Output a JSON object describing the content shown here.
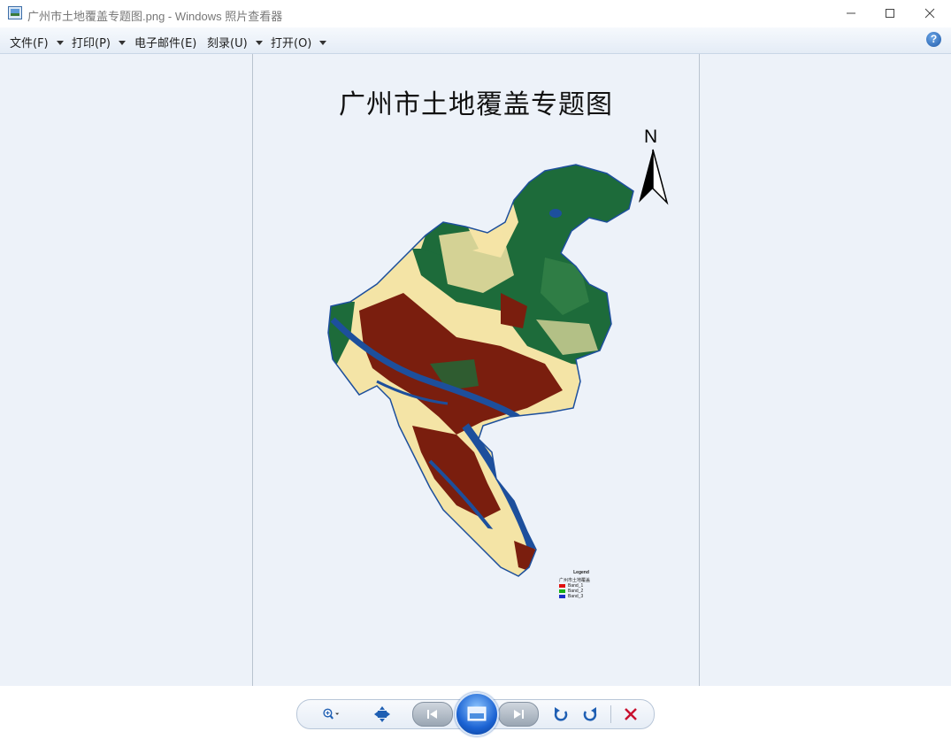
{
  "window": {
    "title": "广州市土地覆盖专题图.png - Windows 照片查看器",
    "controls": [
      "minimize",
      "maximize",
      "close"
    ]
  },
  "menu": {
    "items": [
      {
        "label": "文件(F)",
        "has_dropdown": true
      },
      {
        "label": "打印(P)",
        "has_dropdown": true
      },
      {
        "label": "电子邮件(E)",
        "has_dropdown": false
      },
      {
        "label": "刻录(U)",
        "has_dropdown": true
      },
      {
        "label": "打开(O)",
        "has_dropdown": true
      }
    ],
    "help_icon": "help-icon"
  },
  "map": {
    "title": "广州市土地覆盖专题图",
    "north_label": "N",
    "colors": {
      "urban": "#7a1e0e",
      "forest": "#1d6b3a",
      "water": "#1d4f9c",
      "farmland": "#f4e4a6"
    },
    "legend": {
      "title": "Legend",
      "subtitle": "广州市土地覆盖",
      "entries": [
        {
          "label": "Band_1",
          "color": "#e01010"
        },
        {
          "label": "Band_2",
          "color": "#18b018"
        },
        {
          "label": "Band_3",
          "color": "#1a2fc8"
        }
      ]
    }
  },
  "toolbar": {
    "buttons": [
      "zoom-icon",
      "actual-size-icon",
      "previous-icon",
      "slideshow-icon",
      "next-icon",
      "rotate-left-icon",
      "rotate-right-icon",
      "delete-icon"
    ],
    "colors": {
      "delete": "#c8102e",
      "rotate": "#1f5fb3"
    }
  }
}
